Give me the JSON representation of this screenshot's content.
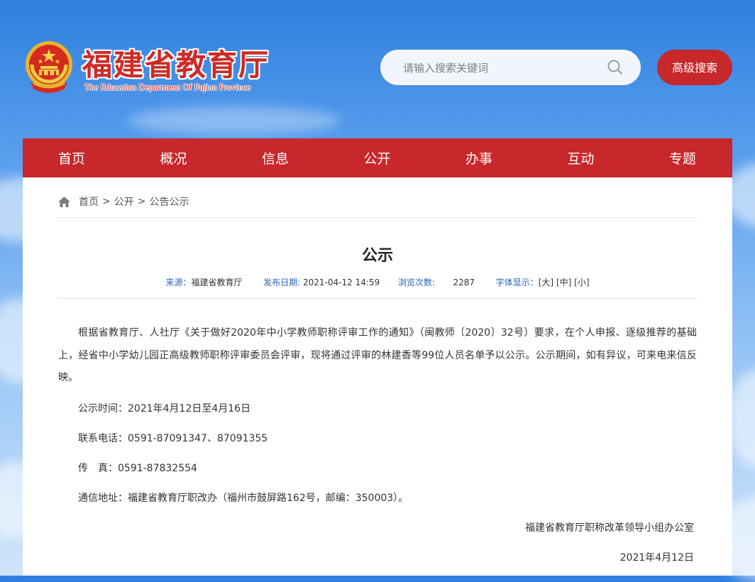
{
  "header": {
    "site_title": "福建省教育厅",
    "site_subtitle": "The Education Department Of Fujian Province",
    "search_placeholder": "请输入搜索关键词",
    "search_value": "",
    "advanced_search_label": "高级搜索"
  },
  "nav": {
    "items": [
      "首页",
      "概况",
      "信息",
      "公开",
      "办事",
      "互动",
      "专题"
    ]
  },
  "breadcrumb": {
    "items": [
      "首页",
      "公开",
      "公告公示"
    ],
    "separator": ">"
  },
  "article": {
    "title": "公示",
    "meta": {
      "source_label": "来源：",
      "source": "福建省教育厅",
      "date_label": "发布日期:",
      "date": "2021-04-12 14:59",
      "views_label": "浏览次数:",
      "views": "2287",
      "font_label": "字体显示：",
      "font_large": "[大]",
      "font_medium": "[中]",
      "font_small": "[小]"
    },
    "paragraph": "根据省教育厅、人社厅《关于做好2020年中小学教师职称评审工作的通知》（闽教师〔2020〕32号）要求，在个人申报、逐级推荐的基础上，经省中小学幼儿园正高级教师职称评审委员会评审，现将通过评审的林建香等99位人员名单予以公示。公示期间，如有异议，可来电来信反映。",
    "period": "公示时间：2021年4月12日至4月16日",
    "phone": "联系电话：0591-87091347、87091355",
    "fax": "传　真：0591-87832554",
    "address": "通信地址：福建省教育厅职改办（福州市鼓屏路162号，邮编：350003）。",
    "signature": "福建省教育厅职称改革领导小组办公室",
    "sign_date": "2021年4月12日"
  },
  "colors": {
    "brand_red": "#c8272b",
    "meta_blue": "#2a63b5",
    "sky_top": "#2f7fe0",
    "sky_bottom": "#cfe4fb"
  }
}
